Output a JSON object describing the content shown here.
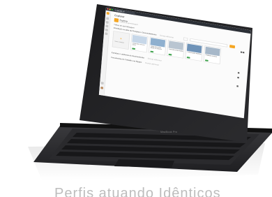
{
  "browser": {
    "tab_title": "r-ubutle.tv",
    "dots": [
      "#ff5f56",
      "#ffbd2e",
      "#27c93f"
    ]
  },
  "app": {
    "page_title": "Explorar",
    "course": {
      "name": "Explorar",
      "subtitle": "3 trilhas de aprendizagem"
    },
    "section_label": "Trilhas de aprendizagem",
    "tracks": [
      {
        "label": "Introdução ao pilar da Pesquisa e Desenvolvimento",
        "extra": "Deseja adicionar"
      },
      {
        "label": "Estrutura e ambiente do desenvolvedor",
        "extra": "Deseja adicionar"
      },
      {
        "label": "Ferramentas do Trabalho em Equipe",
        "extra": "Deseja adicionar"
      }
    ],
    "add_card_label": "Novo conteúdo",
    "cards": [
      {
        "title": "Como fazer um bom pitch?",
        "thumb": "#c7d7e8"
      },
      {
        "title": "Saiba mais sobre gestão de projetos",
        "thumb": "#8fb0cf"
      },
      {
        "title": "Importância da empatia",
        "thumb": "#b9c5d1"
      },
      {
        "title": "Comunicação assertiva",
        "thumb": "#6f93b8"
      },
      {
        "title": "Feedback contínuo",
        "thumb": "#a7b8c9"
      }
    ],
    "accent_color": "#f5a623"
  },
  "device": {
    "keyboard_label": "MacBook Pro"
  },
  "caption": "Perfis atuando Idênticos"
}
